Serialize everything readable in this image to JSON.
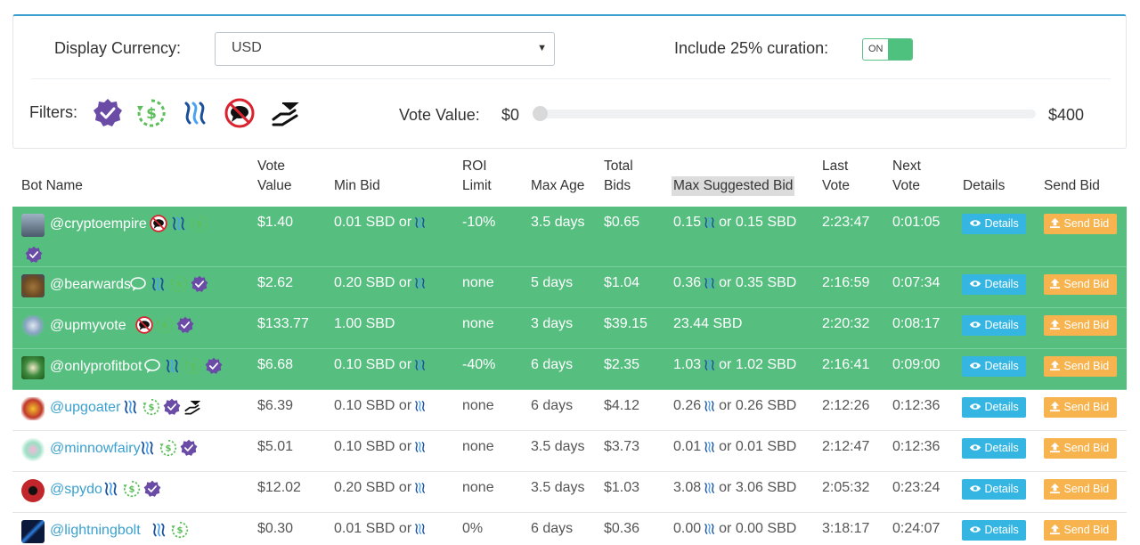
{
  "settings": {
    "display_currency_label": "Display Currency:",
    "currency_value": "USD",
    "curation_label": "Include 25% curation:",
    "curation_toggle": "ON",
    "filters_label": "Filters:",
    "vote_value_label": "Vote Value:",
    "vote_min": "$0",
    "vote_max": "$400"
  },
  "filter_icons": [
    "verified-icon",
    "refund-icon",
    "steem-icon",
    "no-comment-icon",
    "hand-icon"
  ],
  "columns": [
    "Bot Name",
    "Vote\nValue",
    "Min Bid",
    "ROI\nLimit",
    "Max Age",
    "Total\nBids",
    "Max Suggested Bid",
    "Last\nVote",
    "Next\nVote",
    "Details",
    "Send Bid"
  ],
  "buttons": {
    "details": "Details",
    "send_bid": "Send Bid"
  },
  "rows": [
    {
      "name": "@cryptoempire",
      "vote": "$1.40",
      "min_pre": "0.01 SBD or",
      "min_steem": true,
      "roi": "-10%",
      "age": "3.5 days",
      "total": "$0.65",
      "max_a": "0.15",
      "max_b": "or 0.15 SBD",
      "last": "2:23:47",
      "next": "0:01:05"
    },
    {
      "name": "@bearwards",
      "vote": "$2.62",
      "min_pre": "0.20 SBD or",
      "min_steem": true,
      "roi": "none",
      "age": "5 days",
      "total": "$1.04",
      "max_a": "0.36",
      "max_b": "or 0.35 SBD",
      "last": "2:16:59",
      "next": "0:07:34"
    },
    {
      "name": "@upmyvote",
      "vote": "$133.77",
      "min_pre": "1.00 SBD",
      "min_steem": false,
      "roi": "none",
      "age": "3 days",
      "total": "$39.15",
      "max_a": "23.44 SBD",
      "max_b": "",
      "last": "2:20:32",
      "next": "0:08:17"
    },
    {
      "name": "@onlyprofitbot",
      "vote": "$6.68",
      "min_pre": "0.10 SBD or",
      "min_steem": true,
      "roi": "-40%",
      "age": "6 days",
      "total": "$2.35",
      "max_a": "1.03",
      "max_b": "or 1.02 SBD",
      "last": "2:16:41",
      "next": "0:09:00"
    },
    {
      "name": "@upgoater",
      "vote": "$6.39",
      "min_pre": "0.10 SBD or",
      "min_steem": true,
      "roi": "none",
      "age": "6 days",
      "total": "$4.12",
      "max_a": "0.26",
      "max_b": "or 0.26 SBD",
      "last": "2:12:26",
      "next": "0:12:36"
    },
    {
      "name": "@minnowfairy",
      "vote": "$5.01",
      "min_pre": "0.10 SBD or",
      "min_steem": true,
      "roi": "none",
      "age": "3.5 days",
      "total": "$3.73",
      "max_a": "0.01",
      "max_b": "or 0.01 SBD",
      "last": "2:12:47",
      "next": "0:12:36"
    },
    {
      "name": "@spydo",
      "vote": "$12.02",
      "min_pre": "0.20 SBD or",
      "min_steem": true,
      "roi": "none",
      "age": "3.5 days",
      "total": "$1.03",
      "max_a": "3.08",
      "max_b": "or 3.06 SBD",
      "last": "2:05:32",
      "next": "0:23:24"
    },
    {
      "name": "@lightningbolt",
      "vote": "$0.30",
      "min_pre": "0.01 SBD or",
      "min_steem": true,
      "roi": "0%",
      "age": "6 days",
      "total": "$0.36",
      "max_a": "0.00",
      "max_b": "or 0.00 SBD",
      "last": "3:18:17",
      "next": "0:24:07"
    }
  ],
  "colors": {
    "green_row": "#56bf80",
    "details_btn": "#35b5e2",
    "send_btn": "#f7b34e",
    "link": "#3aa0cf"
  }
}
